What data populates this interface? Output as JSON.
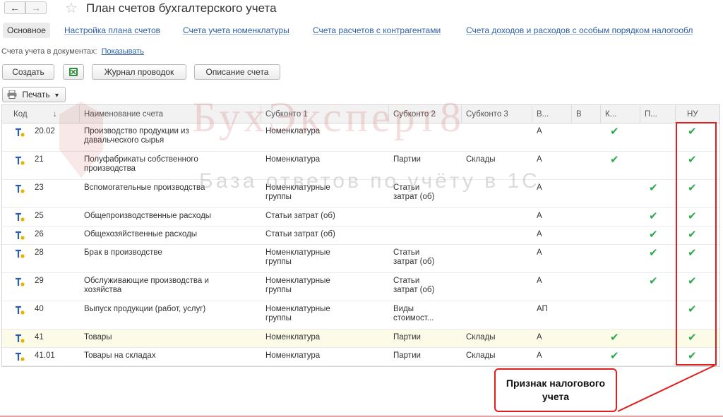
{
  "window": {
    "title": "План счетов бухгалтерского учета",
    "back_icon": "←",
    "forward_icon": "→",
    "star_icon": "☆"
  },
  "tabs": [
    {
      "label": "Основное",
      "active": true
    },
    {
      "label": "Настройка плана счетов"
    },
    {
      "label": "Счета учета номенклатуры"
    },
    {
      "label": "Счета расчетов с контрагентами"
    },
    {
      "label": "Счета доходов и расходов с особым порядком налогообл"
    }
  ],
  "accounts_in_docs": {
    "label": "Счета учета в документах:",
    "link": "Показывать"
  },
  "toolbar": {
    "create": "Создать",
    "journal": "Журнал проводок",
    "description": "Описание счета",
    "print": "Печать",
    "print_caret": "▾"
  },
  "grid": {
    "columns": {
      "code": "Код",
      "sort_arrow": "↓",
      "name": "Наименование счета",
      "sub1": "Субконто 1",
      "sub2": "Субконто 2",
      "sub3": "Субконто 3",
      "v1": "В...",
      "v2": "В",
      "k": "К...",
      "p": "П...",
      "nu": "НУ"
    },
    "rows": [
      {
        "code": "20.02",
        "name": "Производство продукции из\nдавальческого сырья",
        "sub1": "Номенклатура",
        "sub2": "",
        "sub3": "",
        "v": "А",
        "k": "✔",
        "p": "",
        "nu": "✔"
      },
      {
        "code": "21",
        "name": "Полуфабрикаты собственного\nпроизводства",
        "sub1": "Номенклатура",
        "sub2": "Партии",
        "sub3": "Склады",
        "v": "А",
        "k": "✔",
        "p": "",
        "nu": "✔"
      },
      {
        "code": "23",
        "name": "Вспомогательные производства",
        "sub1": "Номенклатурные\nгруппы",
        "sub2": "Статьи\nзатрат (об)",
        "sub3": "",
        "v": "А",
        "k": "",
        "p": "✔",
        "nu": "✔"
      },
      {
        "code": "25",
        "name": "Общепроизводственные расходы",
        "sub1": "Статьи затрат (об)",
        "sub2": "",
        "sub3": "",
        "v": "А",
        "k": "",
        "p": "✔",
        "nu": "✔"
      },
      {
        "code": "26",
        "name": "Общехозяйственные расходы",
        "sub1": "Статьи затрат (об)",
        "sub2": "",
        "sub3": "",
        "v": "А",
        "k": "",
        "p": "✔",
        "nu": "✔"
      },
      {
        "code": "28",
        "name": "Брак в производстве",
        "sub1": "Номенклатурные\nгруппы",
        "sub2": "Статьи\nзатрат (об)",
        "sub3": "",
        "v": "А",
        "k": "",
        "p": "✔",
        "nu": "✔"
      },
      {
        "code": "29",
        "name": "Обслуживающие производства и\nхозяйства",
        "sub1": "Номенклатурные\nгруппы",
        "sub2": "Статьи\nзатрат (об)",
        "sub3": "",
        "v": "А",
        "k": "",
        "p": "✔",
        "nu": "✔"
      },
      {
        "code": "40",
        "name": "Выпуск продукции (работ, услуг)",
        "sub1": "Номенклатурные\nгруппы",
        "sub2": "Виды\nстоимост...",
        "sub3": "",
        "v": "АП",
        "k": "",
        "p": "",
        "nu": "✔"
      },
      {
        "code": "41",
        "name": "Товары",
        "sub1": "Номенклатура",
        "sub2": "Партии",
        "sub3": "Склады",
        "v": "А",
        "k": "✔",
        "p": "",
        "nu": "✔"
      },
      {
        "code": "41.01",
        "name": "Товары на складах",
        "sub1": "Номенклатура",
        "sub2": "Партии",
        "sub3": "Склады",
        "v": "А",
        "k": "✔",
        "p": "",
        "nu": "✔"
      }
    ]
  },
  "watermark": {
    "title": "БухЭксперт8",
    "subtitle": "База ответов по учёту в 1С"
  },
  "annotation": {
    "text": "Признак налогового\nучета"
  },
  "colors": {
    "accent_link": "#2d5fa6",
    "check": "#2eaa4e",
    "highlight": "#e31c1c",
    "selected_row": "#fbfbe8"
  }
}
